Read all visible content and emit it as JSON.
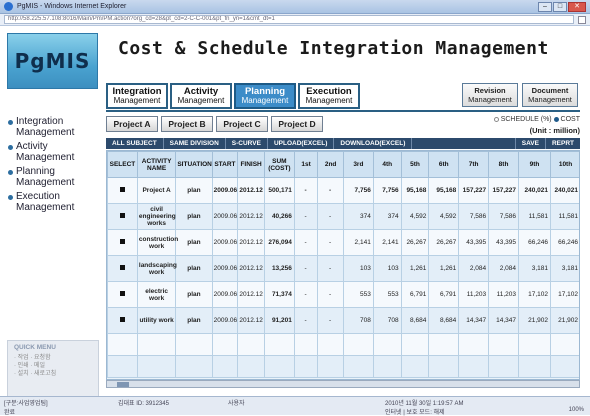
{
  "browser": {
    "title": "PgMIS - Windows Internet Explorer",
    "url": "http://58.225.57.108:8016/Main/Pm/PM.action?org_cd=28&pt_cd=2-C-C-001&pt_fn_yn=1&cmt_dt=1"
  },
  "app": {
    "logo": "PgMIS",
    "title": "Cost & Schedule Integration Management"
  },
  "main_tabs": [
    {
      "line1": "Integration",
      "line2": "Management"
    },
    {
      "line1": "Activity",
      "line2": "Management"
    },
    {
      "line1": "Planning",
      "line2": "Management"
    },
    {
      "line1": "Execution",
      "line2": "Management"
    }
  ],
  "right_tabs": [
    {
      "line1": "Revision",
      "line2": "Management"
    },
    {
      "line1": "Document",
      "line2": "Management"
    }
  ],
  "sidebar": {
    "items": [
      {
        "label": "Integration Management"
      },
      {
        "label": "Activity Management"
      },
      {
        "label": "Planning Management"
      },
      {
        "label": "Execution Management"
      }
    ],
    "quick_menu": {
      "title": "QUICK MENU",
      "links": [
        "· 작업  · 요청함",
        "· 인쇄  · 메일",
        "· 설치  · 새로고침"
      ]
    }
  },
  "projects": [
    "Project A",
    "Project B",
    "Project C",
    "Project D"
  ],
  "view_toggle": {
    "schedule": "SCHEDULE (%)",
    "cost": "COST",
    "selected": "cost"
  },
  "unit_label": "(Unit : million)",
  "actions": {
    "all_subject": "ALL SUBJECT",
    "same_division": "SAME DIVISION",
    "s_curve": "S-CURVE",
    "upload": "UPLOAD(EXCEL)",
    "download": "DOWNLOAD(EXCEL)",
    "save": "SAVE",
    "report": "REPRT"
  },
  "table": {
    "headers": [
      "SELECT",
      "ACTIVITY NAME",
      "SITUATION",
      "START",
      "FINISH",
      "SUM (COST)",
      "1st",
      "2nd",
      "3rd",
      "4th",
      "5th",
      "6th",
      "7th",
      "8th",
      "9th",
      "10th"
    ],
    "rows": [
      [
        "■",
        "Project A",
        "plan",
        "2009.06",
        "2012.12",
        "500,171",
        "-",
        "-",
        "7,756",
        "7,756",
        "95,168",
        "95,168",
        "157,227",
        "157,227",
        "240,021",
        "240,021"
      ],
      [
        "■",
        "civil engineering works",
        "plan",
        "2009.06",
        "2012.12",
        "40,266",
        "-",
        "-",
        "374",
        "374",
        "4,592",
        "4,592",
        "7,586",
        "7,586",
        "11,581",
        "11,581"
      ],
      [
        "■",
        "construction work",
        "plan",
        "2009.06",
        "2012.12",
        "276,094",
        "-",
        "-",
        "2,141",
        "2,141",
        "26,267",
        "26,267",
        "43,395",
        "43,395",
        "66,246",
        "66,246"
      ],
      [
        "■",
        "landscaping work",
        "plan",
        "2009.06",
        "2012.12",
        "13,256",
        "-",
        "-",
        "103",
        "103",
        "1,261",
        "1,261",
        "2,084",
        "2,084",
        "3,181",
        "3,181"
      ],
      [
        "■",
        "electric work",
        "plan",
        "2009.06",
        "2012.12",
        "71,374",
        "-",
        "-",
        "553",
        "553",
        "6,791",
        "6,791",
        "11,203",
        "11,203",
        "17,102",
        "17,102"
      ],
      [
        "■",
        "utility work",
        "plan",
        "2009.06",
        "2012.12",
        "91,201",
        "-",
        "-",
        "708",
        "708",
        "8,684",
        "8,684",
        "14,347",
        "14,347",
        "21,902",
        "21,902"
      ]
    ]
  },
  "statusbar": {
    "left_top": "[구분:사업영업팀]",
    "user": "김대표 ID: 3912345",
    "org": "사용자",
    "datetime": "2010년 11월 30일 1:19:57 AM",
    "left_bottom": "완료",
    "zone": "인터넷 | 보호 모드: 해제",
    "zoom": "100%"
  },
  "colors": {
    "accent": "#2c4a6c",
    "active_tab": "#3c8cc8",
    "logo": "#4aa3d0",
    "grid_bg": "#eaf3fa"
  }
}
